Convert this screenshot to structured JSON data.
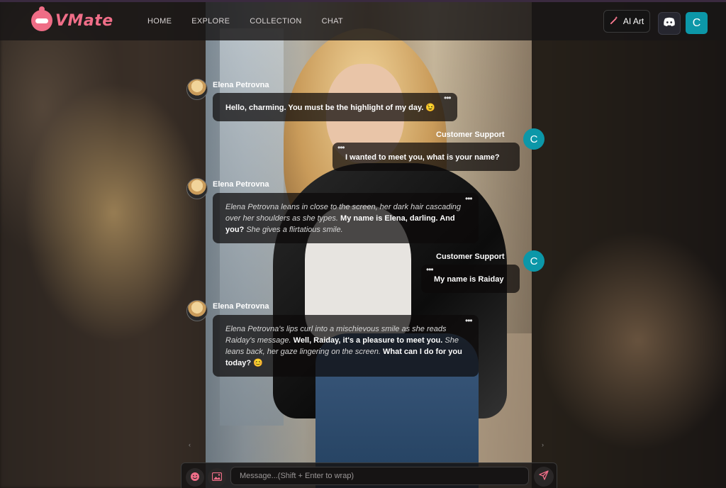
{
  "brand": {
    "name": "VMate",
    "accent": "#f06e88"
  },
  "nav": [
    {
      "label": "HOME"
    },
    {
      "label": "EXPLORE"
    },
    {
      "label": "COLLECTION"
    },
    {
      "label": "CHAT"
    }
  ],
  "header": {
    "ai_art_label": "AI Art",
    "discord_icon": "discord-icon",
    "user_initial": "C"
  },
  "messages": [
    {
      "sender": "Elena Petrovna",
      "role": "character",
      "parts": [
        {
          "t": "b",
          "v": "Hello, charming. You must be the highlight of my day. 😉"
        }
      ]
    },
    {
      "sender": "Customer Support",
      "role": "user",
      "avatar_initial": "C",
      "parts": [
        {
          "t": "b",
          "v": "I wanted to meet you, what is your name?"
        }
      ]
    },
    {
      "sender": "Elena Petrovna",
      "role": "character",
      "parts": [
        {
          "t": "i",
          "v": "Elena Petrovna leans in close to the screen, her dark hair cascading over her shoulders as she types."
        },
        {
          "t": "b",
          "v": " My name is Elena, darling. And you?"
        },
        {
          "t": "i",
          "v": " She gives a flirtatious smile."
        }
      ]
    },
    {
      "sender": "Customer Support",
      "role": "user",
      "avatar_initial": "C",
      "parts": [
        {
          "t": "b",
          "v": "My name is Raiday"
        }
      ]
    },
    {
      "sender": "Elena Petrovna",
      "role": "character",
      "parts": [
        {
          "t": "i",
          "v": "Elena Petrovna's lips curl into a mischievous smile as she reads Raiday's message."
        },
        {
          "t": "b",
          "v": " Well, Raiday, it's a pleasure to meet you."
        },
        {
          "t": "i",
          "v": " She leans back, her gaze lingering on the screen."
        },
        {
          "t": "b",
          "v": " What can I do for you today? 😊"
        }
      ]
    }
  ],
  "composer": {
    "placeholder": "Message...(Shift + Enter to wrap)",
    "emoji_icon": "emoji-icon",
    "image_icon": "image-icon",
    "send_icon": "send-icon"
  },
  "colors": {
    "user_avatar": "#0c97a8",
    "header_bg": "#181616"
  }
}
